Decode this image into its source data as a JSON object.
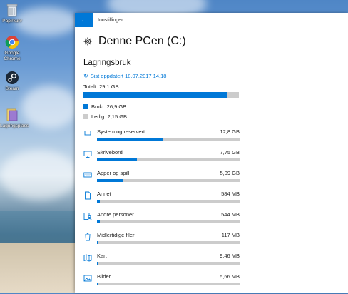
{
  "desktop": {
    "icons": [
      {
        "label": "Papirkurv",
        "icon": "recycle-bin-icon"
      },
      {
        "label": "Google Chrome",
        "icon": "chrome-icon"
      },
      {
        "label": "Steam",
        "icon": "steam-icon"
      },
      {
        "label": "Lagringsplass",
        "icon": "folder-icon"
      }
    ]
  },
  "window": {
    "title": "Innstillinger",
    "back_icon": "arrow-left-icon"
  },
  "page": {
    "title": "Denne PCen (C:)",
    "section": "Lagringsbruk",
    "updated": "Sist oppdatert 18.07.2017 14.18",
    "total": "Totalt: 29,1 GB",
    "used_fraction": 0.925,
    "used_label": "Brukt: 26,9 GB",
    "free_label": "Ledig: 2,15 GB"
  },
  "colors": {
    "accent": "#0078d7",
    "track": "#cccccc"
  },
  "categories": [
    {
      "name": "System og reservert",
      "size": "12,8 GB",
      "fraction": 0.465,
      "icon": "laptop-icon"
    },
    {
      "name": "Skrivebord",
      "size": "7,75 GB",
      "fraction": 0.28,
      "icon": "monitor-icon"
    },
    {
      "name": "Apper og spill",
      "size": "5,09 GB",
      "fraction": 0.185,
      "icon": "keyboard-icon"
    },
    {
      "name": "Annet",
      "size": "584 MB",
      "fraction": 0.02,
      "icon": "document-icon"
    },
    {
      "name": "Andre personer",
      "size": "544 MB",
      "fraction": 0.02,
      "icon": "person-icon"
    },
    {
      "name": "Midlertidige filer",
      "size": "117 MB",
      "fraction": 0.005,
      "icon": "trash-icon"
    },
    {
      "name": "Kart",
      "size": "9,46 MB",
      "fraction": 0.003,
      "icon": "map-icon"
    },
    {
      "name": "Bilder",
      "size": "5,66 MB",
      "fraction": 0.002,
      "icon": "picture-icon"
    }
  ]
}
